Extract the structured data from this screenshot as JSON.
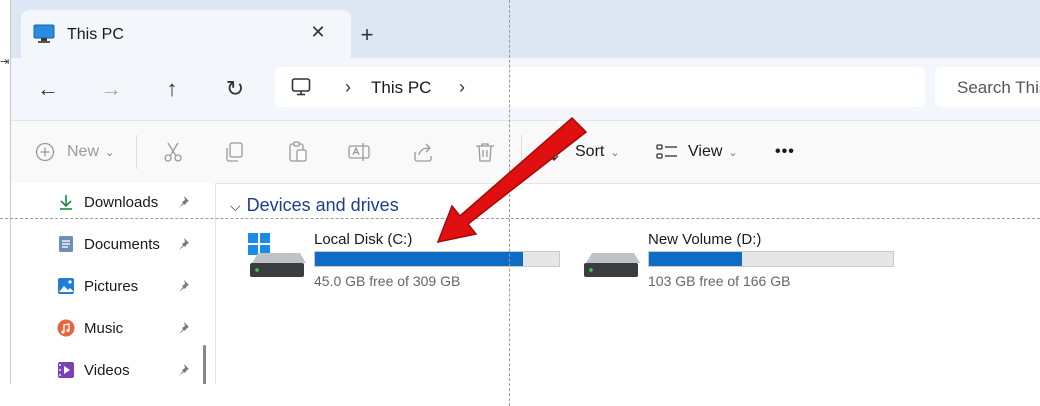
{
  "window": {
    "tab_title": "This PC",
    "tab_close": "✕",
    "new_tab": "+"
  },
  "nav": {
    "back": "←",
    "forward": "→",
    "up": "↑",
    "refresh": "↻",
    "chevron": "›",
    "breadcrumb": "This PC",
    "search_placeholder": "Search This PC"
  },
  "commands": {
    "new_label": "New",
    "sort_label": "Sort",
    "view_label": "View",
    "more_label": "•••",
    "caret": "⌄"
  },
  "sidebar": {
    "items": [
      {
        "label": "Downloads",
        "icon": "download-icon"
      },
      {
        "label": "Documents",
        "icon": "documents-icon"
      },
      {
        "label": "Pictures",
        "icon": "pictures-icon"
      },
      {
        "label": "Music",
        "icon": "music-icon"
      },
      {
        "label": "Videos",
        "icon": "videos-icon"
      }
    ],
    "pin": "📌"
  },
  "content": {
    "group_header": "Devices and drives",
    "group_chevron": "⌵",
    "drives": [
      {
        "name": "Local Disk (C:)",
        "free_text": "45.0 GB free of 309 GB",
        "used_fraction": 0.854
      },
      {
        "name": "New Volume (D:)",
        "free_text": "103 GB free of 166 GB",
        "used_fraction": 0.38
      }
    ]
  },
  "colors": {
    "accent": "#0f6cc4",
    "annotation_arrow": "#e01010",
    "group_header": "#1e3e8a"
  }
}
